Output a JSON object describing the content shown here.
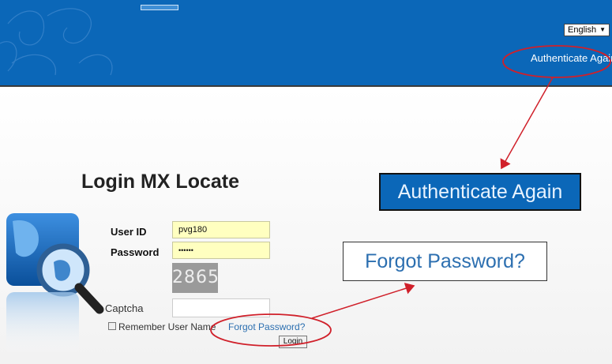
{
  "header": {
    "language": {
      "selected": "English",
      "dropdown_arrow": "▼"
    },
    "authenticate_link": "Authenticate Again"
  },
  "login": {
    "title": "Login MX Locate",
    "user_id_label": "User ID",
    "user_id_value": "pvg180",
    "password_label": "Password",
    "password_value": "••••••",
    "captcha_image_text": "2865",
    "captcha_label": "Captcha",
    "captcha_value": "",
    "remember_label": "Remember User Name",
    "remember_checked": false,
    "forgot_link": "Forgot Password?",
    "login_button": "Login"
  },
  "annotations": {
    "zoom_authenticate": "Authenticate Again",
    "zoom_forgot": "Forgot Password?",
    "highlight_color": "#d0202a",
    "header_color": "#0b67b8"
  }
}
